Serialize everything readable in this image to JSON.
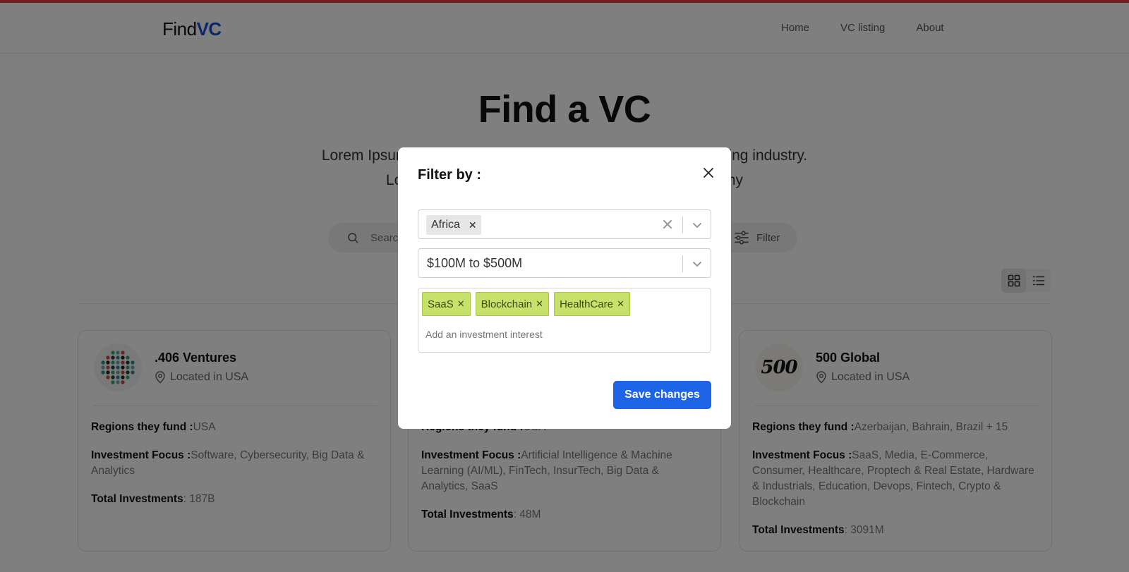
{
  "header": {
    "logo_part1": "Find",
    "logo_part2": "VC",
    "nav": [
      "Home",
      "VC listing",
      "About"
    ]
  },
  "hero": {
    "title": "Find a VC",
    "subtitle_line1": "Lorem Ipsum is simply dummy text of the printing and typesetting industry.",
    "subtitle_line2": "Lorem Ipsum has been the industry's standard dummy"
  },
  "search": {
    "placeholder": "Search",
    "filter_label": "Filter"
  },
  "cards": [
    {
      "name": ".406 Ventures",
      "location": "Located in USA",
      "regions_label": "Regions they fund :",
      "regions": "USA",
      "focus_label": "Investment Focus :",
      "focus": "Software, Cybersecurity, Big Data & Analytics",
      "total_label": "Total Investments",
      "total": ": 187B"
    },
    {
      "name": "",
      "location": "",
      "regions_label": "Regions they fund :",
      "regions": "USA",
      "focus_label": "Investment Focus :",
      "focus": "Artificial Intelligence & Machine Learning (AI/ML), FinTech, InsurTech, Big Data & Analytics, SaaS",
      "total_label": "Total Investments",
      "total": ": 48M"
    },
    {
      "name": "500 Global",
      "location": "Located in USA",
      "logo_text": "500",
      "regions_label": "Regions they fund :",
      "regions": "Azerbaijan, Bahrain, Brazil + 15",
      "focus_label": "Investment Focus :",
      "focus": "SaaS, Media, E-Commerce, Consumer, Healthcare, Proptech & Real Estate, Hardware & Industrials, Education, Devops, Fintech, Crypto & Blockchain",
      "total_label": "Total Investments",
      "total": ": 3091M"
    }
  ],
  "modal": {
    "title": "Filter by :",
    "region_chips": [
      "Africa"
    ],
    "range_value": "$100M to $500M",
    "interest_tags": [
      "SaaS",
      "Blockchain",
      "HealthCare"
    ],
    "interest_placeholder": "Add an investment interest",
    "save_label": "Save changes"
  },
  "colors": {
    "accent": "#1e64e6",
    "logo_accent": "#1a4fd6",
    "tag_bg": "#c6e26b",
    "top_border": "#e03a3a"
  },
  "icons": [
    "search-icon",
    "filter-icon",
    "grid-view-icon",
    "list-view-icon",
    "location-pin-icon",
    "close-icon",
    "clear-icon",
    "chevron-down-icon"
  ]
}
